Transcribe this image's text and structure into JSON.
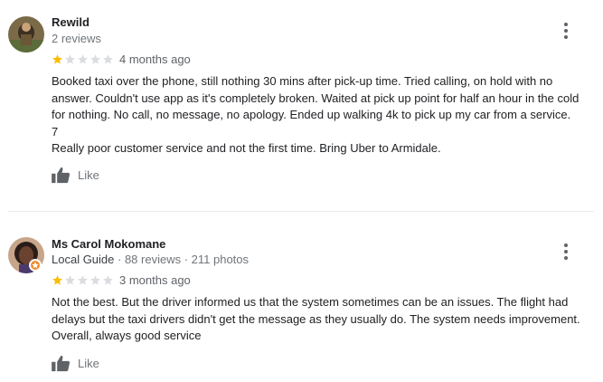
{
  "reviews": [
    {
      "reviewer_name": "Rewild",
      "reviewer_meta": "2 reviews",
      "rating": 1,
      "rating_max": 5,
      "time": "4 months ago",
      "text": "Booked taxi over the phone, still nothing 30 mins after pick-up time. Tried calling, on hold with no\nanswer. Couldn't use app as it's completely broken. Waited at pick up point for half an hour in the cold\nfor nothing. No call, no message, no apology. Ended up walking 4k to pick up my car from a service.\n7\nReally poor customer service and not the first time. Bring Uber to Armidale.",
      "like_label": "Like",
      "avatar": "reviewer-photo-icon"
    },
    {
      "reviewer_name": "Ms Carol Mokomane",
      "reviewer_badge": "Local Guide",
      "reviewer_meta": "88 reviews · 211 photos",
      "rating": 1,
      "rating_max": 5,
      "time": "3 months ago",
      "text": "Not the best. But the driver informed us that the system sometimes can be an issues. The flight had\ndelays but the taxi drivers didn't get the message as they usually do. The system needs improvement.\nOverall, always good service",
      "like_label": "Like",
      "avatar": "reviewer-photo-icon"
    }
  ],
  "colors": {
    "star_filled": "#fbbc04",
    "star_empty": "#dadce0",
    "guide_badge": "#ef8c2e",
    "meta_text": "#70757a"
  },
  "icons": [
    "more-vert-icon",
    "star-icon",
    "thumbs-up-icon",
    "local-guide-badge-icon"
  ]
}
